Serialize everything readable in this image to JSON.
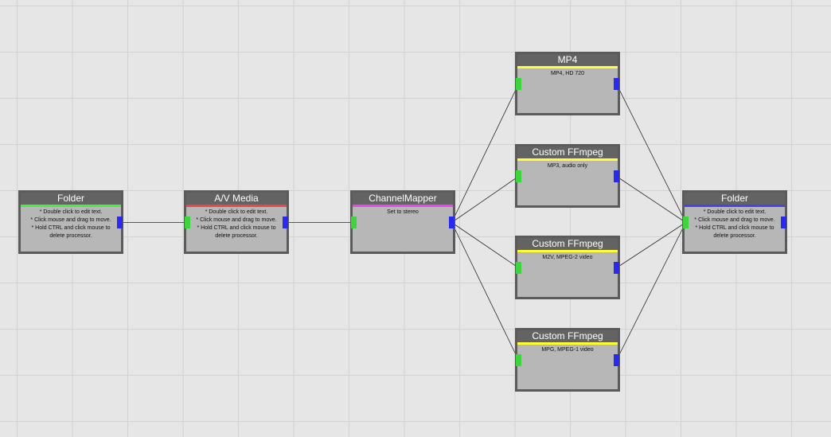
{
  "canvas": {
    "background": "#e6e6e6",
    "grid_color": "#d2d2d2",
    "wire_color": "#2a2a2a"
  },
  "ports": {
    "input_color": "#3ed43e",
    "output_color": "#2a2aee"
  },
  "nodes": {
    "folder_in": {
      "title": "Folder",
      "stripe_color": "#44ee44",
      "text": "* Double click to edit text.\n* Click mouse and drag to move.\n* Hold CTRL and click mouse to delete processor."
    },
    "av_media": {
      "title": "A/V Media",
      "stripe_color": "#ee4444",
      "text": "* Double click to edit text.\n* Click mouse and drag to move.\n* Hold CTRL and click mouse to delete processor."
    },
    "channel_mapper": {
      "title": "ChannelMapper",
      "stripe_color": "#ee44ee",
      "text": "Set to stereo"
    },
    "mp4": {
      "title": "MP4",
      "stripe_color": "#ffff33",
      "text": "MP4, HD 720"
    },
    "ffmpeg_mp3": {
      "title": "Custom FFmpeg",
      "stripe_color": "#ffff33",
      "text": "MP3, audio only"
    },
    "ffmpeg_m2v": {
      "title": "Custom FFmpeg",
      "stripe_color": "#ffff33",
      "text": "M2V, MPEG-2 video"
    },
    "ffmpeg_mpg": {
      "title": "Custom FFmpeg",
      "stripe_color": "#ffff33",
      "text": "MPG, MPEG-1 video"
    },
    "folder_out": {
      "title": "Folder",
      "stripe_color": "#4444ee",
      "text": "* Double click to edit text.\n* Click mouse and drag to move.\n* Hold CTRL and click mouse to delete processor."
    }
  },
  "connections": [
    [
      "folder_in",
      "av_media"
    ],
    [
      "av_media",
      "channel_mapper"
    ],
    [
      "channel_mapper",
      "mp4"
    ],
    [
      "channel_mapper",
      "ffmpeg_mp3"
    ],
    [
      "channel_mapper",
      "ffmpeg_m2v"
    ],
    [
      "channel_mapper",
      "ffmpeg_mpg"
    ],
    [
      "mp4",
      "folder_out"
    ],
    [
      "ffmpeg_mp3",
      "folder_out"
    ],
    [
      "ffmpeg_m2v",
      "folder_out"
    ],
    [
      "ffmpeg_mpg",
      "folder_out"
    ]
  ]
}
